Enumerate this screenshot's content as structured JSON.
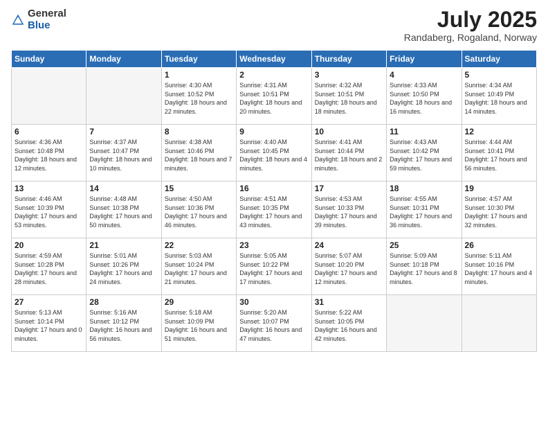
{
  "header": {
    "logo_general": "General",
    "logo_blue": "Blue",
    "month_title": "July 2025",
    "location": "Randaberg, Rogaland, Norway"
  },
  "weekdays": [
    "Sunday",
    "Monday",
    "Tuesday",
    "Wednesday",
    "Thursday",
    "Friday",
    "Saturday"
  ],
  "weeks": [
    [
      {
        "day": "",
        "sunrise": "",
        "sunset": "",
        "daylight": "",
        "empty": true
      },
      {
        "day": "",
        "sunrise": "",
        "sunset": "",
        "daylight": "",
        "empty": true
      },
      {
        "day": "1",
        "sunrise": "Sunrise: 4:30 AM",
        "sunset": "Sunset: 10:52 PM",
        "daylight": "Daylight: 18 hours and 22 minutes."
      },
      {
        "day": "2",
        "sunrise": "Sunrise: 4:31 AM",
        "sunset": "Sunset: 10:51 PM",
        "daylight": "Daylight: 18 hours and 20 minutes."
      },
      {
        "day": "3",
        "sunrise": "Sunrise: 4:32 AM",
        "sunset": "Sunset: 10:51 PM",
        "daylight": "Daylight: 18 hours and 18 minutes."
      },
      {
        "day": "4",
        "sunrise": "Sunrise: 4:33 AM",
        "sunset": "Sunset: 10:50 PM",
        "daylight": "Daylight: 18 hours and 16 minutes."
      },
      {
        "day": "5",
        "sunrise": "Sunrise: 4:34 AM",
        "sunset": "Sunset: 10:49 PM",
        "daylight": "Daylight: 18 hours and 14 minutes."
      }
    ],
    [
      {
        "day": "6",
        "sunrise": "Sunrise: 4:36 AM",
        "sunset": "Sunset: 10:48 PM",
        "daylight": "Daylight: 18 hours and 12 minutes."
      },
      {
        "day": "7",
        "sunrise": "Sunrise: 4:37 AM",
        "sunset": "Sunset: 10:47 PM",
        "daylight": "Daylight: 18 hours and 10 minutes."
      },
      {
        "day": "8",
        "sunrise": "Sunrise: 4:38 AM",
        "sunset": "Sunset: 10:46 PM",
        "daylight": "Daylight: 18 hours and 7 minutes."
      },
      {
        "day": "9",
        "sunrise": "Sunrise: 4:40 AM",
        "sunset": "Sunset: 10:45 PM",
        "daylight": "Daylight: 18 hours and 4 minutes."
      },
      {
        "day": "10",
        "sunrise": "Sunrise: 4:41 AM",
        "sunset": "Sunset: 10:44 PM",
        "daylight": "Daylight: 18 hours and 2 minutes."
      },
      {
        "day": "11",
        "sunrise": "Sunrise: 4:43 AM",
        "sunset": "Sunset: 10:42 PM",
        "daylight": "Daylight: 17 hours and 59 minutes."
      },
      {
        "day": "12",
        "sunrise": "Sunrise: 4:44 AM",
        "sunset": "Sunset: 10:41 PM",
        "daylight": "Daylight: 17 hours and 56 minutes."
      }
    ],
    [
      {
        "day": "13",
        "sunrise": "Sunrise: 4:46 AM",
        "sunset": "Sunset: 10:39 PM",
        "daylight": "Daylight: 17 hours and 53 minutes."
      },
      {
        "day": "14",
        "sunrise": "Sunrise: 4:48 AM",
        "sunset": "Sunset: 10:38 PM",
        "daylight": "Daylight: 17 hours and 50 minutes."
      },
      {
        "day": "15",
        "sunrise": "Sunrise: 4:50 AM",
        "sunset": "Sunset: 10:36 PM",
        "daylight": "Daylight: 17 hours and 46 minutes."
      },
      {
        "day": "16",
        "sunrise": "Sunrise: 4:51 AM",
        "sunset": "Sunset: 10:35 PM",
        "daylight": "Daylight: 17 hours and 43 minutes."
      },
      {
        "day": "17",
        "sunrise": "Sunrise: 4:53 AM",
        "sunset": "Sunset: 10:33 PM",
        "daylight": "Daylight: 17 hours and 39 minutes."
      },
      {
        "day": "18",
        "sunrise": "Sunrise: 4:55 AM",
        "sunset": "Sunset: 10:31 PM",
        "daylight": "Daylight: 17 hours and 36 minutes."
      },
      {
        "day": "19",
        "sunrise": "Sunrise: 4:57 AM",
        "sunset": "Sunset: 10:30 PM",
        "daylight": "Daylight: 17 hours and 32 minutes."
      }
    ],
    [
      {
        "day": "20",
        "sunrise": "Sunrise: 4:59 AM",
        "sunset": "Sunset: 10:28 PM",
        "daylight": "Daylight: 17 hours and 28 minutes."
      },
      {
        "day": "21",
        "sunrise": "Sunrise: 5:01 AM",
        "sunset": "Sunset: 10:26 PM",
        "daylight": "Daylight: 17 hours and 24 minutes."
      },
      {
        "day": "22",
        "sunrise": "Sunrise: 5:03 AM",
        "sunset": "Sunset: 10:24 PM",
        "daylight": "Daylight: 17 hours and 21 minutes."
      },
      {
        "day": "23",
        "sunrise": "Sunrise: 5:05 AM",
        "sunset": "Sunset: 10:22 PM",
        "daylight": "Daylight: 17 hours and 17 minutes."
      },
      {
        "day": "24",
        "sunrise": "Sunrise: 5:07 AM",
        "sunset": "Sunset: 10:20 PM",
        "daylight": "Daylight: 17 hours and 12 minutes."
      },
      {
        "day": "25",
        "sunrise": "Sunrise: 5:09 AM",
        "sunset": "Sunset: 10:18 PM",
        "daylight": "Daylight: 17 hours and 8 minutes."
      },
      {
        "day": "26",
        "sunrise": "Sunrise: 5:11 AM",
        "sunset": "Sunset: 10:16 PM",
        "daylight": "Daylight: 17 hours and 4 minutes."
      }
    ],
    [
      {
        "day": "27",
        "sunrise": "Sunrise: 5:13 AM",
        "sunset": "Sunset: 10:14 PM",
        "daylight": "Daylight: 17 hours and 0 minutes."
      },
      {
        "day": "28",
        "sunrise": "Sunrise: 5:16 AM",
        "sunset": "Sunset: 10:12 PM",
        "daylight": "Daylight: 16 hours and 56 minutes."
      },
      {
        "day": "29",
        "sunrise": "Sunrise: 5:18 AM",
        "sunset": "Sunset: 10:09 PM",
        "daylight": "Daylight: 16 hours and 51 minutes."
      },
      {
        "day": "30",
        "sunrise": "Sunrise: 5:20 AM",
        "sunset": "Sunset: 10:07 PM",
        "daylight": "Daylight: 16 hours and 47 minutes."
      },
      {
        "day": "31",
        "sunrise": "Sunrise: 5:22 AM",
        "sunset": "Sunset: 10:05 PM",
        "daylight": "Daylight: 16 hours and 42 minutes."
      },
      {
        "day": "",
        "sunrise": "",
        "sunset": "",
        "daylight": "",
        "empty": true
      },
      {
        "day": "",
        "sunrise": "",
        "sunset": "",
        "daylight": "",
        "empty": true
      }
    ]
  ]
}
